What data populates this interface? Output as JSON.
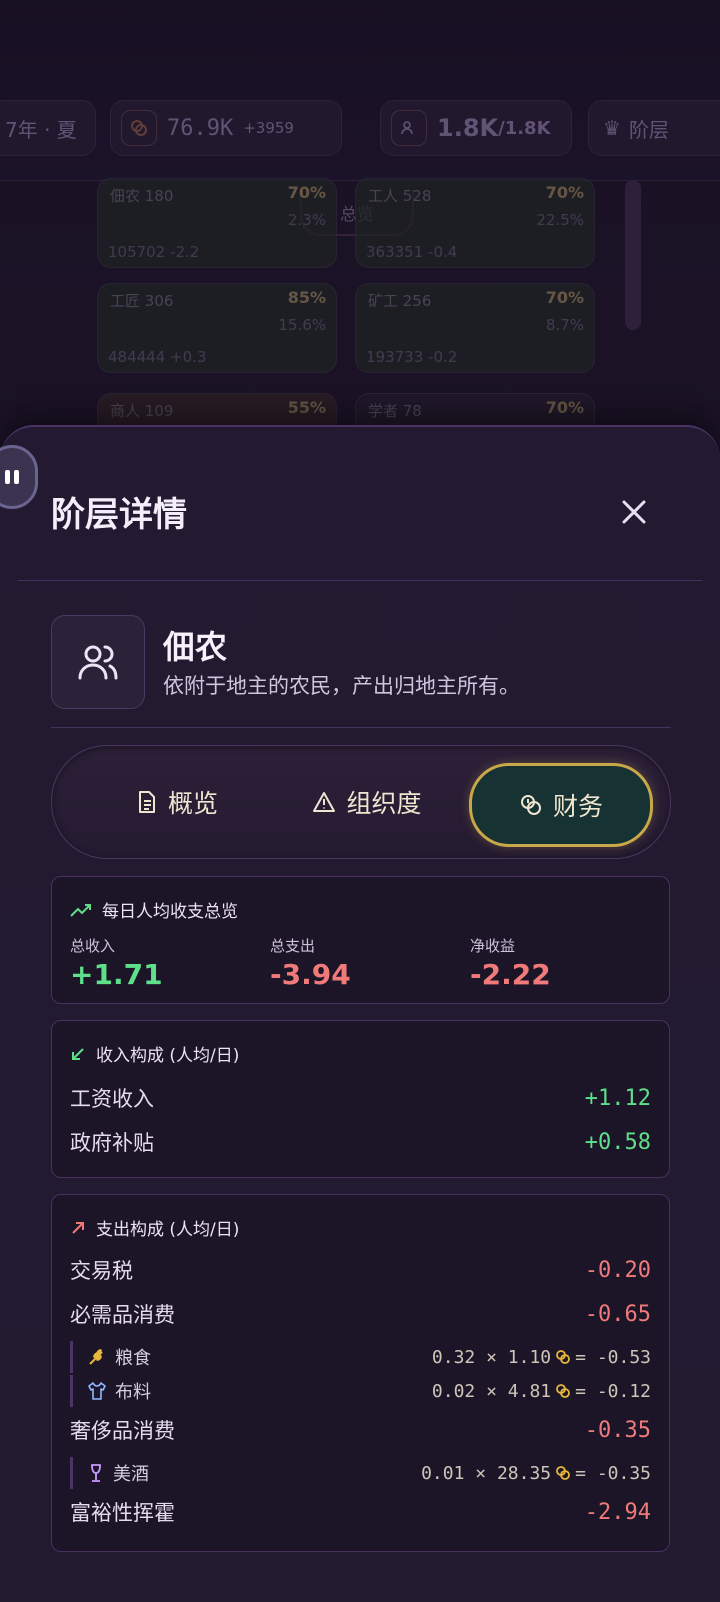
{
  "background": {
    "season_chip": "7年 · 夏",
    "silver_value": "76.9K",
    "silver_delta": "+3959",
    "population": "1.8K",
    "population_cap": "/1.8K",
    "strata_label": "阶层",
    "overview_tab": "总览",
    "cards": [
      {
        "name": "佃农 180",
        "pct": "70%",
        "sub": "2.3%",
        "bottom": "105702 -2.2"
      },
      {
        "name": "工人 528",
        "pct": "70%",
        "sub": "22.5%",
        "bottom": "363351 -0.4"
      },
      {
        "name": "工匠 306",
        "pct": "85%",
        "sub": "15.6%",
        "bottom": "484444 +0.3"
      },
      {
        "name": "矿工 256",
        "pct": "70%",
        "sub": "8.7%",
        "bottom": "193733 -0.2"
      },
      {
        "name": "商人 109",
        "pct": "55%"
      },
      {
        "name": "学者 78",
        "pct": "70%"
      }
    ]
  },
  "sheet": {
    "title": "阶层详情",
    "class_name": "佃农",
    "class_desc": "依附于地主的农民，产出归地主所有。",
    "tabs": [
      {
        "label": "概览"
      },
      {
        "label": "组织度"
      },
      {
        "label": "财务"
      }
    ]
  },
  "summary": {
    "title": "每日人均收支总览",
    "income_label": "总收入",
    "income_value": "+1.71",
    "expense_label": "总支出",
    "expense_value": "-3.94",
    "net_label": "净收益",
    "net_value": "-2.22"
  },
  "income": {
    "title": "收入构成 (人均/日)",
    "rows": [
      {
        "label": "工资收入",
        "value": "+1.12"
      },
      {
        "label": "政府补贴",
        "value": "+0.58"
      }
    ]
  },
  "expense": {
    "title": "支出构成 (人均/日)",
    "trade_tax": {
      "label": "交易税",
      "value": "-0.20"
    },
    "necessities": {
      "label": "必需品消费",
      "value": "-0.65"
    },
    "grain": {
      "label": "粮食",
      "formula": "0.32 × 1.10",
      "result": "= -0.53"
    },
    "cloth": {
      "label": "布料",
      "formula": "0.02 × 4.81",
      "result": "= -0.12"
    },
    "luxury": {
      "label": "奢侈品消费",
      "value": "-0.35"
    },
    "wine": {
      "label": "美酒",
      "formula": "0.01 × 28.35",
      "result": "= -0.35"
    },
    "lavish": {
      "label": "富裕性挥霍",
      "value": "-2.94"
    }
  },
  "colors": {
    "accent_gold": "#c9a84a",
    "positive": "#5ee08a",
    "negative": "#f07a7a"
  }
}
